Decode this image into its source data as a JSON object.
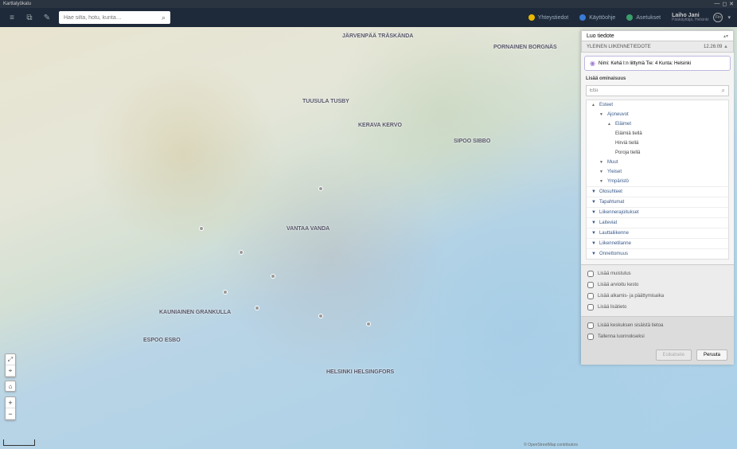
{
  "titlebar": {
    "title": "Karttatyökalu"
  },
  "header": {
    "search_placeholder": "Hae silta, hotu, kunta…",
    "links": {
      "contact": "Yhteystiedot",
      "help": "Käyttöohje",
      "settings": "Asetukset"
    },
    "user": {
      "name": "Laiho Jani",
      "role": "Pääkäyttäjä, Helsinki",
      "lang": "Fin"
    }
  },
  "map_labels": {
    "jarvenpaa": "JÄRVENPÄÄ TRÄSKÄNDA",
    "pornainen": "PORNAINEN BORGNÄS",
    "tuusula": "TUUSULA TUSBY",
    "kerava": "KERAVA KERVO",
    "sipoo": "SIPOO SIBBO",
    "vantaa": "VANTAA VANDA",
    "espoo": "ESPOO ESBO",
    "kauniainen": "KAUNIAINEN GRANKULLA",
    "helsinki": "HELSINKI HELSINGFORS"
  },
  "panel": {
    "header": "Luo tiedote",
    "subheader": "YLEINEN LIIKENNETIEDOTE",
    "time": "12.26:09",
    "location": "Nimi: Kehä I:n liittymä   Tie: 4   Kunta: Helsinki",
    "section_title": "Lisää ominaisuus",
    "filter_placeholder": "Etsi",
    "tree": {
      "esteet": "Esteet",
      "ajoneuvot": "Ajoneuvot",
      "elaimet": "Eläimet",
      "elaimia_tiella": "Eläimiä tiellä",
      "hirvia_tiella": "Hirviä tiellä",
      "poroja_tiella": "Poroja tiellä",
      "muut": "Muut",
      "yleiset": "Yleiset",
      "ymparisto": "Ympäristö"
    },
    "cats": {
      "olosuhteet": "Olosuhteet",
      "tapahtumat": "Tapahtumat",
      "liikennerajoitukset": "Liikennerajoitukset",
      "laitevirhe": "Laiteviat",
      "lauttaliikenne": "Lauttaliikenne",
      "liikennetilanne": "Liikennetilanne",
      "onnettomuus": "Onnettomuus"
    },
    "checks": {
      "muistutus": "Lisää muistutus",
      "arvioitu_kesto": "Lisää arvioitu kesto",
      "alkamis_paattymis": "Lisää alkamis- ja päättymisaika",
      "lisatieto": "Lisää lisätieto",
      "keskuksen_sisaista": "Lisää keskuksen sisäistä tietoa",
      "tallenna_luonnokseksi": "Tallenna luonnokseksi"
    },
    "buttons": {
      "esikatsele": "Esikatsele",
      "peruuta": "Peruuta"
    }
  },
  "attribution": "© OpenStreetMap contributors"
}
